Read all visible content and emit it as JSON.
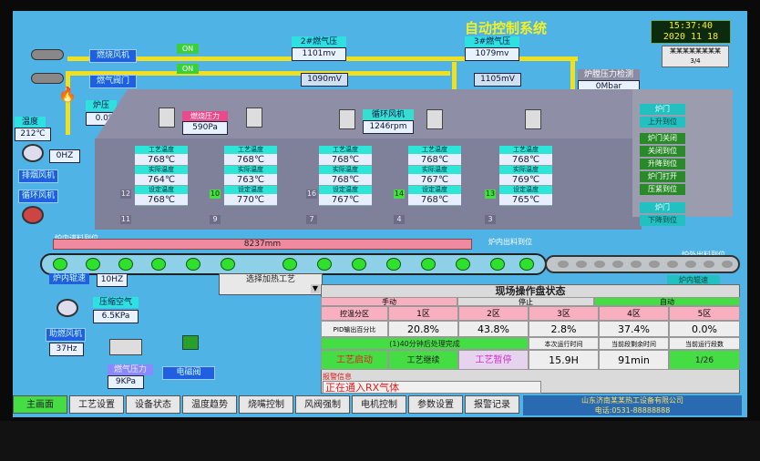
{
  "app": {
    "title": "自动控制系统",
    "time": "15:37:40",
    "date": "2020 11 18",
    "top_right_label": "某某某某某某某某",
    "top_right_value": "3/4"
  },
  "left": {
    "valve1": "ON",
    "valve2": "ON",
    "burner_a": "燃烧风机",
    "burner_b": "燃气阀门",
    "fire_label": "炉压",
    "fire_pct": "0.0%",
    "temp_label": "温度",
    "temp_value": "212℃",
    "freq": "0HZ",
    "fan1": "排烟风机",
    "fan2": "循环风机",
    "speed_label": "炉内辊速",
    "speed_value": "10HZ",
    "pressure_label": "压缩空气",
    "pressure_value": "6.5KPa",
    "motor_label": "助燃风机",
    "motor_value": "37Hz",
    "gas_label": "燃气压力",
    "gas_value": "9KPa",
    "valve_btn": "电磁阀"
  },
  "top_center": {
    "a_label": "2#燃气压",
    "a_value": "1101mv",
    "a_sub": "1090mV",
    "b_label": "3#燃气压",
    "b_value": "1079mv",
    "b_sub": "1105mV",
    "c_label": "炉膛压力检测",
    "c_value": "0Mbar",
    "burner_pressure_label": "燃烧压力",
    "burner_pressure_value": "590Pa",
    "circ_label": "循环风机",
    "circ_value": "1246rpm"
  },
  "zones": [
    {
      "h1": "工艺温度",
      "t1": "768℃",
      "h2": "实际温度",
      "t2": "764℃",
      "h3": "设定温度",
      "t3": "768℃",
      "n1": "12",
      "n2": "11"
    },
    {
      "h1": "工艺温度",
      "t1": "768℃",
      "h2": "实际温度",
      "t2": "763℃",
      "h3": "设定温度",
      "t3": "770℃",
      "n1": "10",
      "n2": "9"
    },
    {
      "h1": "工艺温度",
      "t1": "768℃",
      "h2": "实际温度",
      "t2": "768℃",
      "h3": "设定温度",
      "t3": "767℃",
      "n1": "16",
      "n2": "7"
    },
    {
      "h1": "工艺温度",
      "t1": "768℃",
      "h2": "实际温度",
      "t2": "767℃",
      "h3": "设定温度",
      "t3": "768℃",
      "n1": "14",
      "n2": "4"
    },
    {
      "h1": "工艺温度",
      "t1": "768℃",
      "h2": "实际温度",
      "t2": "769℃",
      "h3": "设定温度",
      "t3": "765℃",
      "n1": "13",
      "n2": "3"
    }
  ],
  "right_panel": [
    {
      "label": "炉门",
      "color": "#22c0c0"
    },
    {
      "label": "上升到位",
      "color": "#22c0c0"
    },
    {
      "label": "炉门关闭",
      "color": "#2a8a2a"
    },
    {
      "label": "关闭到位",
      "color": "#2a8a2a"
    },
    {
      "label": "升降到位",
      "color": "#2a8a2a"
    },
    {
      "label": "炉门打开",
      "color": "#2a8a2a"
    },
    {
      "label": "压紧到位",
      "color": "#2a8a2a"
    },
    {
      "label": "炉门",
      "color": "#22c0c0"
    },
    {
      "label": "下降到位",
      "color": "#22c0c0"
    }
  ],
  "conveyor": {
    "in_label": "炉内进料到位",
    "position": "8237mm",
    "out_label": "炉内出料到位",
    "right_label": "炉外出料到位",
    "select_label": "选择加热工艺",
    "roller_speed": "炉内辊速"
  },
  "status_panel": {
    "title": "现场操作盘状态",
    "modes": [
      "手动",
      "停止",
      "自动"
    ],
    "zone_header": "控温分区",
    "zones": [
      "1区",
      "2区",
      "3区",
      "4区",
      "5区"
    ],
    "row_label": "PID输出百分比",
    "values": [
      "20.8%",
      "43.8%",
      "2.8%",
      "37.4%",
      "0.0%"
    ],
    "warn_text": "(1)40分钟后处理完成",
    "btn1": "工艺启动",
    "btn2": "工艺继续",
    "btn3": "工艺暂停",
    "time_header1": "本次运行时间",
    "time1": "15.9H",
    "time_header2": "当前段剩余时间",
    "time2": "91min",
    "time_header3": "当前运行段数",
    "time3": "1/26",
    "msg_header": "报警信息",
    "message": "正在通入RX气体",
    "company": "山东济南某某热工设备有限公司",
    "phone": "电话:0531-88888888"
  },
  "tabs": [
    "主画面",
    "工艺设置",
    "设备状态",
    "温度趋势",
    "烧嘴控制",
    "风阀强制",
    "电机控制",
    "参数设置",
    "报警记录"
  ]
}
